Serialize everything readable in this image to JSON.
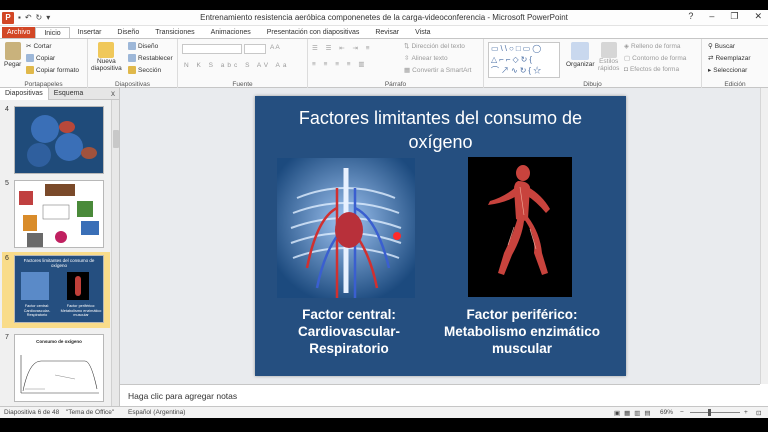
{
  "window": {
    "title": "Entrenamiento resistencia aeróbica componenetes de la carga-videoconferencia - Microsoft PowerPoint",
    "app_letter": "P",
    "controls": [
      "?",
      "–",
      "❐",
      "✕"
    ]
  },
  "tabs": [
    "Archivo",
    "Inicio",
    "Insertar",
    "Diseño",
    "Transiciones",
    "Animaciones",
    "Presentación con diapositivas",
    "Revisar",
    "Vista"
  ],
  "active_tab": "Inicio",
  "ribbon": {
    "portapapeles": {
      "label": "Portapapeles",
      "pegar": "Pegar",
      "cortar": "Cortar",
      "copiar": "Copiar",
      "copiar_formato": "Copiar formato"
    },
    "diapositivas": {
      "label": "Diapositivas",
      "nueva": "Nueva",
      "diapositiva": "diapositiva",
      "diseno": "Diseño",
      "restablecer": "Restablecer",
      "seccion": "Sección"
    },
    "fuente": {
      "label": "Fuente",
      "formatting": "N K S abc S AV Aa"
    },
    "parrafo": {
      "label": "Párrafo",
      "direccion": "Dirección del texto",
      "alinear": "Alinear texto",
      "smartart": "Convertir a SmartArt"
    },
    "dibujo": {
      "label": "Dibujo",
      "organizar": "Organizar",
      "estilos": "Estilos",
      "rapidos": "rápidos",
      "relleno": "Relleno de forma",
      "contorno": "Contorno de forma",
      "efectos": "Efectos de forma"
    },
    "edicion": {
      "label": "Edición",
      "buscar": "Buscar",
      "reemplazar": "Reemplazar",
      "seleccionar": "Seleccionar"
    }
  },
  "panel": {
    "tab_slides": "Diapositivas",
    "tab_outline": "Esquema",
    "close": "x",
    "thumbnails": [
      {
        "num": "4"
      },
      {
        "num": "5"
      },
      {
        "num": "6",
        "title": "Factores limitantes del consumo de oxígeno",
        "left": "Factor central: Cardiovascular-Respiratorio",
        "right": "Factor periférico: Metabolismo enzimático muscular"
      },
      {
        "num": "7",
        "title": "Consumo de oxígeno"
      }
    ]
  },
  "slide": {
    "title": "Factores limitantes del consumo de oxígeno",
    "left_caption": "Factor central: Cardiovascular-Respiratorio",
    "right_caption": "Factor periférico: Metabolismo enzimático muscular",
    "left_image": "anatomía cardiovascular-respiratoria",
    "right_image": "figura muscular corriendo"
  },
  "notes_placeholder": "Haga clic para agregar notas",
  "status": {
    "slide_info": "Diapositiva 6 de 48",
    "theme": "\"Tema de Office\"",
    "language": "Español (Argentina)",
    "zoom": "69%"
  },
  "colors": {
    "accent": "#d24726",
    "slide_bg": "#254f80",
    "selection": "#f9dc8a"
  }
}
